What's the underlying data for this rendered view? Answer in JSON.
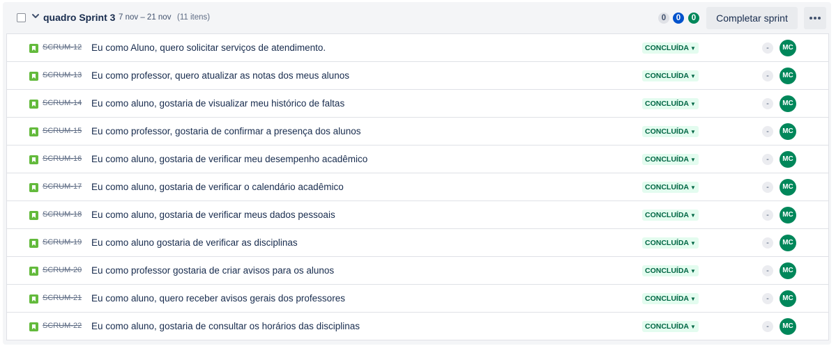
{
  "sprint": {
    "title": "quadro Sprint 3",
    "dates": "7 nov – 21 nov",
    "issue_count": "(11 itens)",
    "status_counts": {
      "todo": "0",
      "in_progress": "0",
      "done": "0"
    },
    "complete_label": "Completar sprint",
    "more_icon": "more-horizontal-icon"
  },
  "colors": {
    "story_icon": "#63ba3c",
    "status_done_bg": "#e3fcef",
    "status_done_text": "#006644",
    "avatar": "#00875a",
    "in_progress_pill": "#0052cc"
  },
  "issues": [
    {
      "key": "SCRUM-12",
      "summary": "Eu como Aluno, quero solicitar serviços de atendimento.",
      "status": "CONCLUÍDA",
      "estimate": "-",
      "assignee": "MC"
    },
    {
      "key": "SCRUM-13",
      "summary": "Eu como professor, quero atualizar as notas dos meus alunos",
      "status": "CONCLUÍDA",
      "estimate": "-",
      "assignee": "MC"
    },
    {
      "key": "SCRUM-14",
      "summary": "Eu como aluno, gostaria de visualizar meu histórico de faltas",
      "status": "CONCLUÍDA",
      "estimate": "-",
      "assignee": "MC"
    },
    {
      "key": "SCRUM-15",
      "summary": "Eu como professor, gostaria de confirmar a presença dos alunos",
      "status": "CONCLUÍDA",
      "estimate": "-",
      "assignee": "MC"
    },
    {
      "key": "SCRUM-16",
      "summary": "Eu como aluno, gostaria de verificar meu desempenho acadêmico",
      "status": "CONCLUÍDA",
      "estimate": "-",
      "assignee": "MC"
    },
    {
      "key": "SCRUM-17",
      "summary": "Eu como aluno, gostaria de verificar o calendário acadêmico",
      "status": "CONCLUÍDA",
      "estimate": "-",
      "assignee": "MC"
    },
    {
      "key": "SCRUM-18",
      "summary": "Eu como aluno, gostaria de verificar meus dados pessoais",
      "status": "CONCLUÍDA",
      "estimate": "-",
      "assignee": "MC"
    },
    {
      "key": "SCRUM-19",
      "summary": "Eu como aluno gostaria de verificar as disciplinas",
      "status": "CONCLUÍDA",
      "estimate": "-",
      "assignee": "MC"
    },
    {
      "key": "SCRUM-20",
      "summary": "Eu como professor gostaria de criar avisos para os alunos",
      "status": "CONCLUÍDA",
      "estimate": "-",
      "assignee": "MC"
    },
    {
      "key": "SCRUM-21",
      "summary": "Eu como aluno, quero receber avisos gerais dos professores",
      "status": "CONCLUÍDA",
      "estimate": "-",
      "assignee": "MC"
    },
    {
      "key": "SCRUM-22",
      "summary": "Eu como aluno, gostaria de consultar os horários das disciplinas",
      "status": "CONCLUÍDA",
      "estimate": "-",
      "assignee": "MC"
    }
  ]
}
